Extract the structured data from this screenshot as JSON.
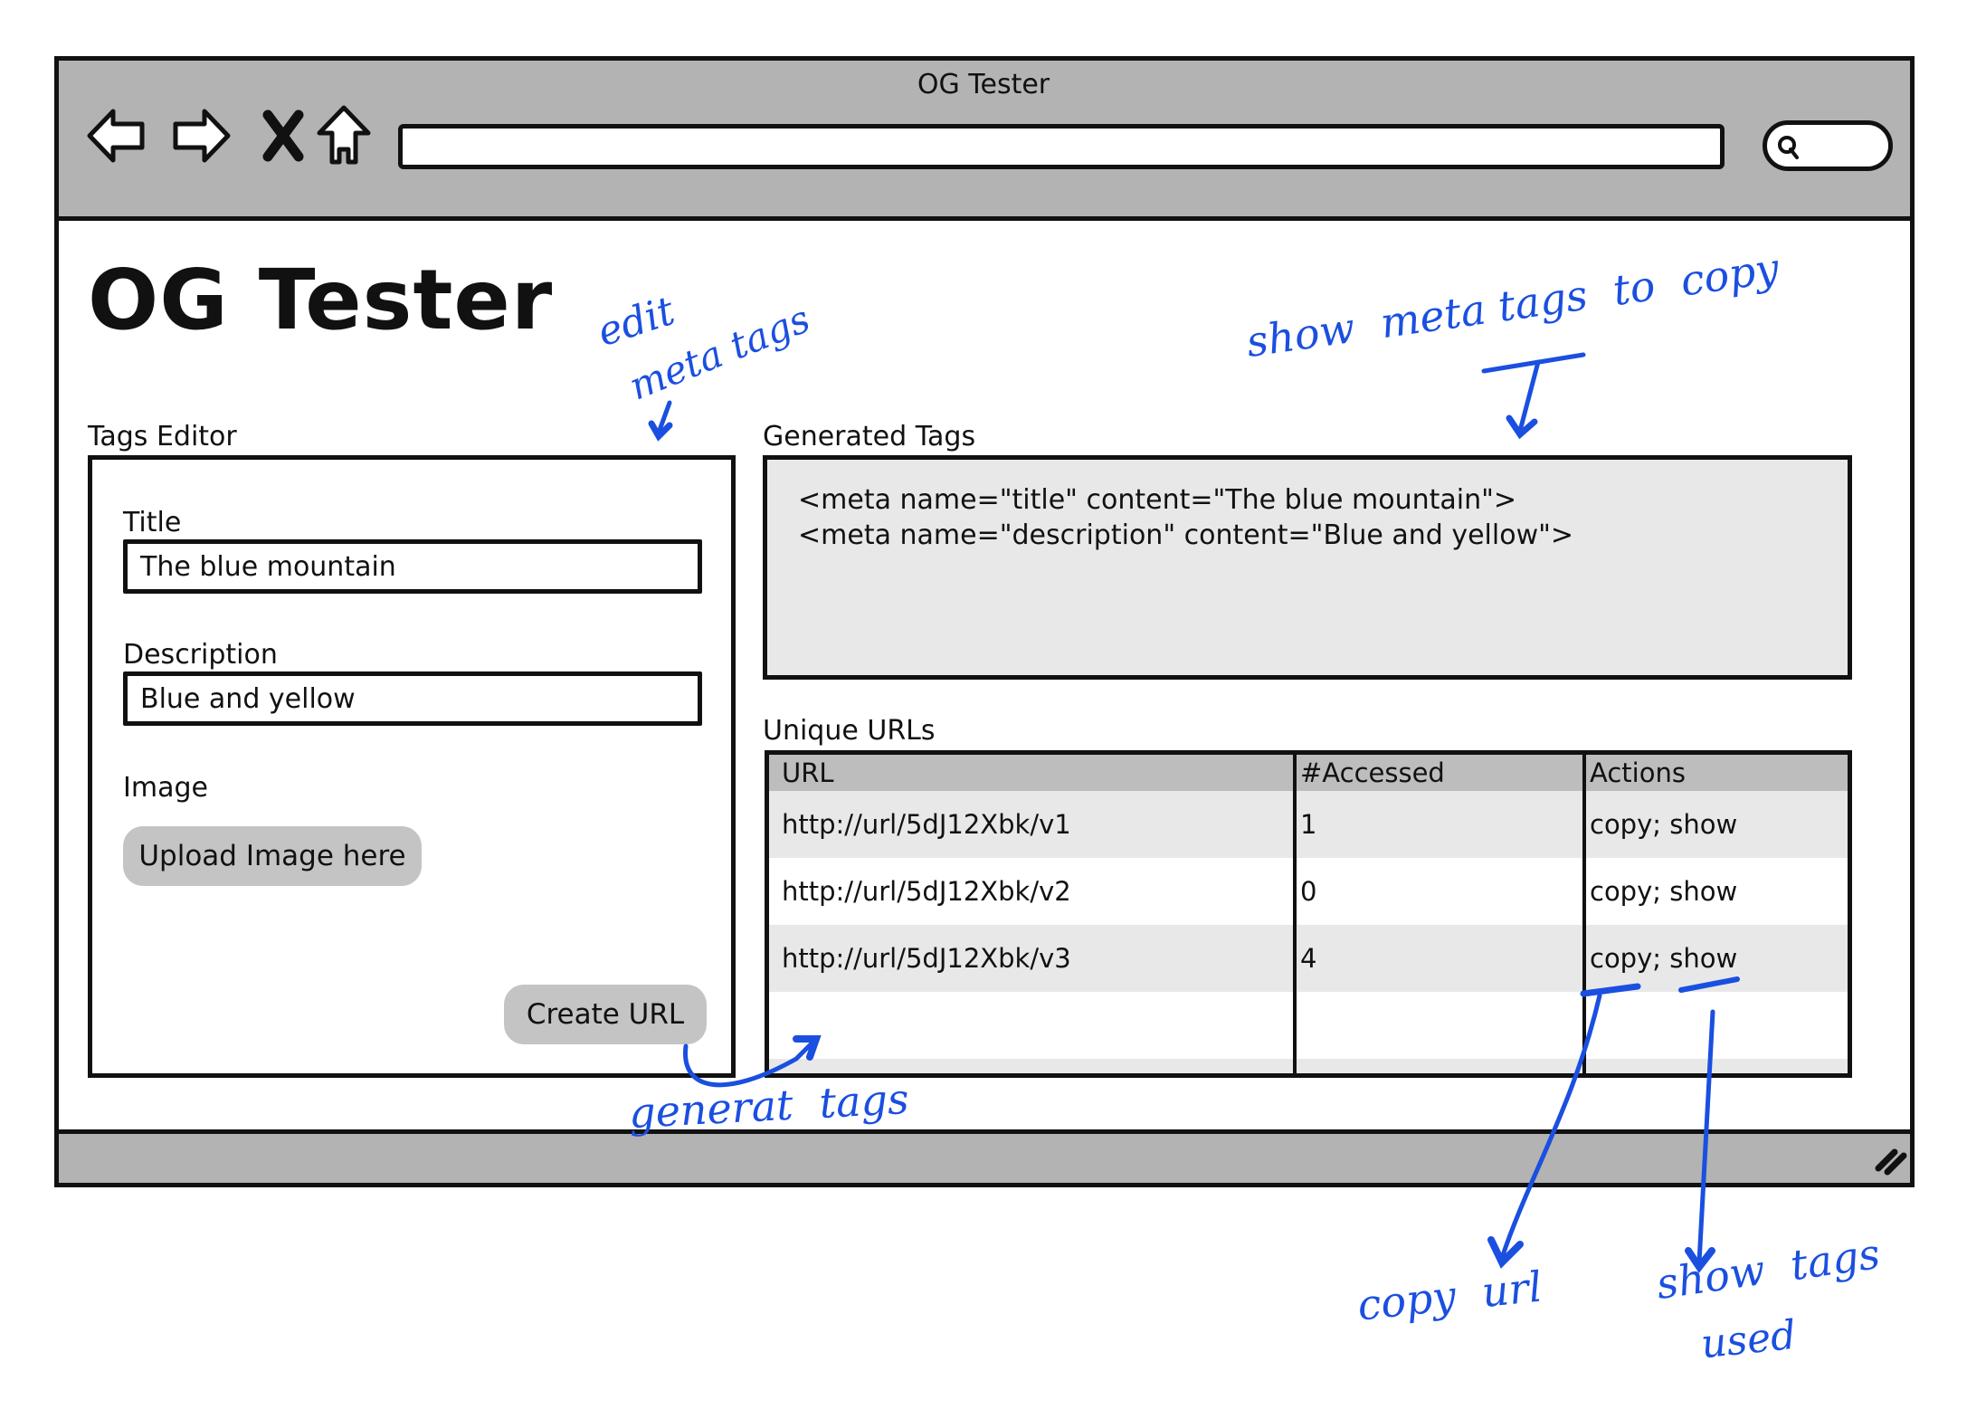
{
  "browser": {
    "window_title": "OG Tester",
    "nav_icons": [
      "back-arrow-icon",
      "forward-arrow-icon",
      "stop-x-icon",
      "home-icon"
    ],
    "url_value": "",
    "search_icon": "search-icon",
    "resize_icon": "resize-grip-icon"
  },
  "page": {
    "title": "OG Tester"
  },
  "tags_editor": {
    "label": "Tags Editor",
    "title_label": "Title",
    "title_value": "The blue mountain",
    "description_label": "Description",
    "description_value": "Blue and yellow",
    "image_label": "Image",
    "upload_button": "Upload Image here",
    "create_button": "Create URL"
  },
  "generated_tags": {
    "label": "Generated Tags",
    "lines": [
      "<meta name=\"title\" content=\"The blue mountain\">",
      "<meta name=\"description\" content=\"Blue and yellow\">"
    ]
  },
  "unique_urls": {
    "label": "Unique URLs",
    "columns": [
      "URL",
      "#Accessed",
      "Actions"
    ],
    "rows": [
      {
        "url": "http://url/5dJ12Xbk/v1",
        "accessed": "1",
        "actions": "copy; show"
      },
      {
        "url": "http://url/5dJ12Xbk/v2",
        "accessed": "0",
        "actions": "copy; show"
      },
      {
        "url": "http://url/5dJ12Xbk/v3",
        "accessed": "4",
        "actions": "copy; show"
      }
    ]
  },
  "annotations": {
    "color": "#1a4fe0",
    "edit_meta_tags_1": "edit",
    "edit_meta_tags_2": "meta tags",
    "show_meta_tags": "show  meta tags  to  copy",
    "generate_tags": "generat  tags",
    "copy_url": "copy  url",
    "show_tags_1": "show  tags",
    "show_tags_2": "used"
  },
  "colors": {
    "chrome_gray": "#b3b3b3",
    "button_gray": "#c4c4c4",
    "panel_gray": "#e8e8e8",
    "header_gray": "#bdbdbd"
  }
}
